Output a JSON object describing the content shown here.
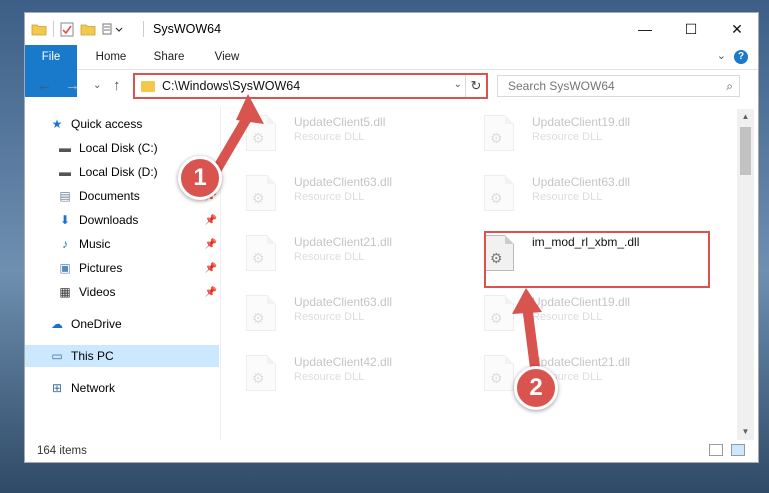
{
  "window": {
    "title": "SysWOW64",
    "controls": {
      "minimize": "—",
      "maximize": "☐",
      "close": "✕"
    }
  },
  "ribbon": {
    "tabs": [
      "File",
      "Home",
      "Share",
      "View"
    ],
    "help": "?",
    "collapse": "⌄"
  },
  "nav": {
    "back": "←",
    "forward": "→",
    "recent": "⌄",
    "up": "↑",
    "address": "C:\\Windows\\SysWOW64",
    "address_chevron": "⌄",
    "refresh": "↻",
    "search_placeholder": "Search SysWOW64",
    "search_icon": "⌕"
  },
  "sidebar": {
    "items": [
      {
        "label": "Quick access",
        "icon": "star-icon",
        "glyph": "★",
        "color": "#1a73c8",
        "pinned": false
      },
      {
        "label": "Local Disk (C:)",
        "icon": "drive-icon",
        "glyph": "▬",
        "color": "#555555",
        "pinned": false
      },
      {
        "label": "Local Disk (D:)",
        "icon": "drive-icon",
        "glyph": "▬",
        "color": "#555555",
        "pinned": false
      },
      {
        "label": "Documents",
        "icon": "documents-icon",
        "glyph": "▤",
        "color": "#6b7f99",
        "pinned": true
      },
      {
        "label": "Downloads",
        "icon": "downloads-icon",
        "glyph": "⬇",
        "color": "#1a73c8",
        "pinned": true
      },
      {
        "label": "Music",
        "icon": "music-icon",
        "glyph": "♪",
        "color": "#1a73c8",
        "pinned": true
      },
      {
        "label": "Pictures",
        "icon": "pictures-icon",
        "glyph": "▣",
        "color": "#5b8ab8",
        "pinned": true
      },
      {
        "label": "Videos",
        "icon": "videos-icon",
        "glyph": "▦",
        "color": "#333333",
        "pinned": true
      },
      {
        "label": "OneDrive",
        "icon": "onedrive-icon",
        "glyph": "☁",
        "color": "#1a73c8",
        "pinned": false
      },
      {
        "label": "This PC",
        "icon": "this-pc-icon",
        "glyph": "▭",
        "color": "#3a6fa8",
        "pinned": false,
        "selected": true
      },
      {
        "label": "Network",
        "icon": "network-icon",
        "glyph": "⊞",
        "color": "#3a6fa8",
        "pinned": false
      }
    ],
    "pin_glyph": "📌"
  },
  "files": [
    {
      "name": "UpdateClient5.dll",
      "type": "Resource DLL",
      "faded": true
    },
    {
      "name": "UpdateClient19.dll",
      "type": "Resource DLL",
      "faded": true
    },
    {
      "name": "UpdateClient63.dll",
      "type": "Resource DLL",
      "faded": true
    },
    {
      "name": "UpdateClient63.dll",
      "type": "Resource DLL",
      "faded": true
    },
    {
      "name": "UpdateClient21.dll",
      "type": "Resource DLL",
      "faded": true
    },
    {
      "name": "im_mod_rl_xbm_.dll",
      "type": "",
      "faded": false
    },
    {
      "name": "UpdateClient63.dll",
      "type": "Resource DLL",
      "faded": true
    },
    {
      "name": "UpdateClient19.dll",
      "type": "Resource DLL",
      "faded": true
    },
    {
      "name": "UpdateClient42.dll",
      "type": "Resource DLL",
      "faded": true
    },
    {
      "name": "UpdateClient21.dll",
      "type": "Resource DLL",
      "faded": true
    }
  ],
  "status": {
    "item_count": "164 items"
  },
  "annotations": {
    "step1": "1",
    "step2": "2",
    "color": "#d9534f"
  }
}
